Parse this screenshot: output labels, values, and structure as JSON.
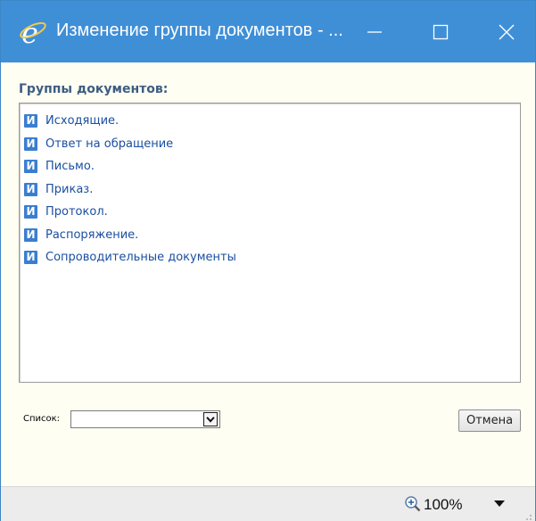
{
  "window": {
    "title": "Изменение группы документов - ...",
    "titlebar_color": "#3f8fd7",
    "icons": {
      "app": "ie-logo-icon",
      "minimize": "minimize-icon",
      "maximize": "maximize-icon",
      "close": "close-icon"
    }
  },
  "groups": {
    "title": "Группы документов:",
    "item_icon_letter": "И",
    "items": [
      {
        "label": "Исходящие."
      },
      {
        "label": "Ответ на обращение"
      },
      {
        "label": "Письмо."
      },
      {
        "label": "Приказ."
      },
      {
        "label": "Протокол."
      },
      {
        "label": "Распоряжение."
      },
      {
        "label": "Сопроводительные документы"
      }
    ]
  },
  "footer": {
    "list_label": "Список:",
    "list_value": "",
    "cancel_label": "Отмена"
  },
  "statusbar": {
    "zoom": "100%",
    "zoom_icon": "zoom-in-icon",
    "dropdown_icon": "triangle-down-icon"
  }
}
